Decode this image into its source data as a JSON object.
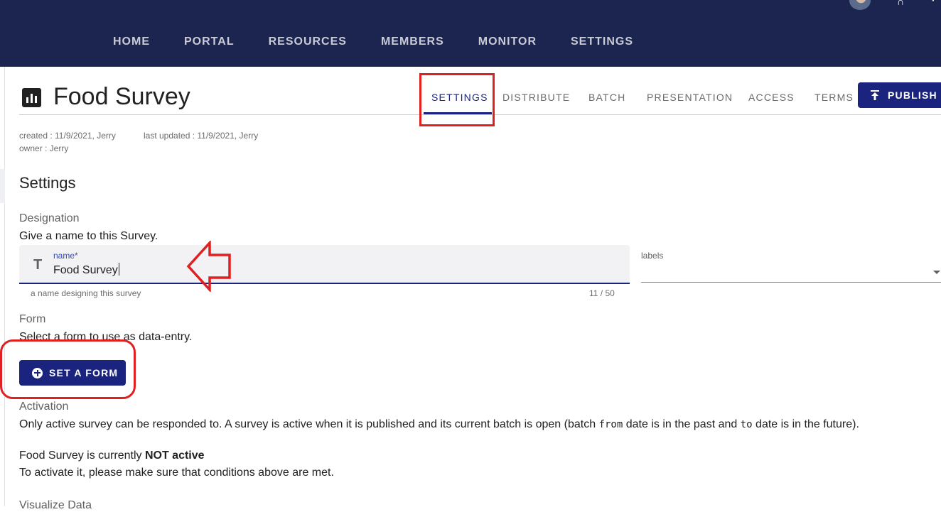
{
  "nav": {
    "items": [
      "HOME",
      "PORTAL",
      "RESOURCES",
      "MEMBERS",
      "MONITOR",
      "SETTINGS"
    ]
  },
  "header": {
    "title": "Food Survey",
    "tabs": [
      "SETTINGS",
      "DISTRIBUTE",
      "BATCH",
      "PRESENTATION",
      "ACCESS",
      "TERMS"
    ],
    "active_tab": "SETTINGS",
    "publish_label": "PUBLISH"
  },
  "meta": {
    "created": "created : 11/9/2021, Jerry",
    "updated": "last updated : 11/9/2021, Jerry",
    "owner": "owner : Jerry"
  },
  "settings": {
    "heading": "Settings",
    "designation": {
      "title": "Designation",
      "description": "Give a name to this Survey.",
      "field_label": "name*",
      "field_value": "Food Survey",
      "hint": "a name designing this survey",
      "counter": "11 / 50",
      "labels_label": "labels"
    },
    "form": {
      "title": "Form",
      "description": "Select a form to use as data-entry.",
      "button_label": "SET A FORM"
    },
    "activation": {
      "title": "Activation",
      "text_part1": "Only active survey can be responded to. A survey is active when it is published and its current batch is open (batch ",
      "code_from": "from",
      "text_part2": " date is in the past and ",
      "code_to": "to",
      "text_part3": " date is in the future).",
      "status_prefix": "Food Survey is currently ",
      "status_value": "NOT active",
      "instruction": "To activate it, please make sure that conditions above are met."
    },
    "visualize_title": "Visualize Data"
  },
  "colors": {
    "topbar": "#1b2550",
    "primary": "#1a237e",
    "annotation": "#e02020"
  }
}
